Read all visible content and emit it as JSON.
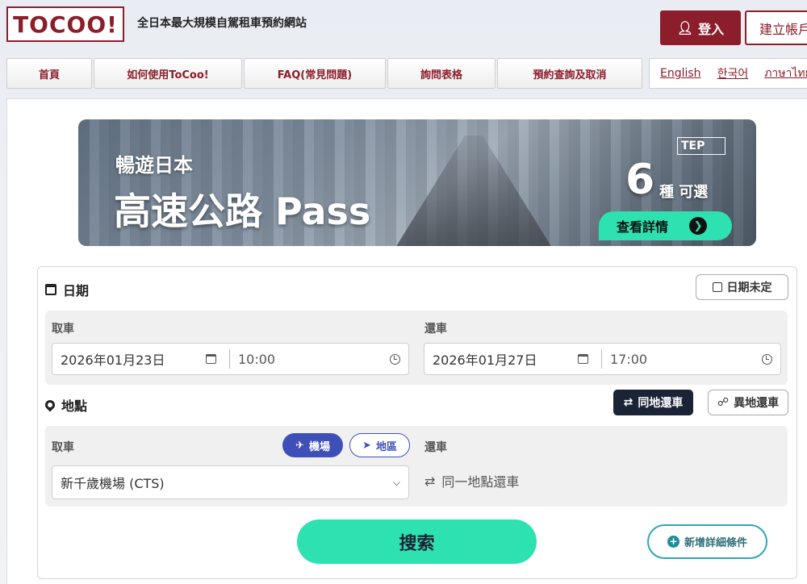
{
  "header": {
    "logo": "TOCOO!",
    "tagline": "全日本最大規模自駕租車預約網站",
    "login_label": "登入",
    "register_label": "建立帳戶"
  },
  "nav": [
    {
      "label": "首頁"
    },
    {
      "label": "如何使用ToCoo!"
    },
    {
      "label": "FAQ(常見問題)"
    },
    {
      "label": "詢問表格"
    },
    {
      "label": "預約查詢及取消"
    }
  ],
  "languages": [
    "English",
    "한국어",
    "ภาษาไทย"
  ],
  "banner": {
    "subtitle": "暢遊日本",
    "title": "高速公路 Pass",
    "badge": "TEP",
    "number": "6",
    "types_text": "種 可選",
    "cta": "查看詳情",
    "cta_arrow": "❯"
  },
  "date_section": {
    "title": "日期",
    "undecided_label": "日期未定",
    "pickup_label": "取車",
    "return_label": "還車",
    "pickup_date": "2026年01月23日",
    "pickup_time": "10:00",
    "return_date": "2026年01月27日",
    "return_time": "17:00"
  },
  "location_section": {
    "title": "地點",
    "same_return_label": "同地還車",
    "different_return_label": "異地還車",
    "pickup_label": "取車",
    "airport_label": "機場",
    "area_label": "地區",
    "pickup_value": "新千歲機場 (CTS)",
    "return_label": "還車",
    "return_same_text": "同一地點還車"
  },
  "actions": {
    "search_label": "搜索",
    "more_conditions_label": "新增詳細條件"
  },
  "colors": {
    "brand": "#8c1d2a",
    "accent": "#2ee1b0",
    "dark": "#1b2336",
    "blue": "#3f4fb8"
  }
}
